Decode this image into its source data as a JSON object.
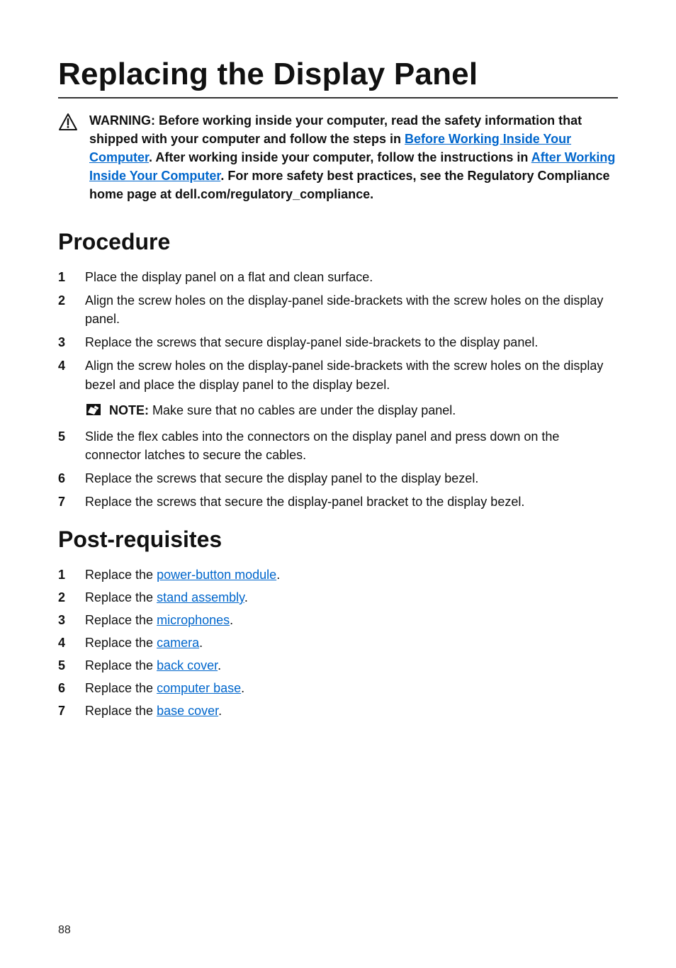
{
  "page": {
    "number": "88"
  },
  "title": "Replacing the Display Panel",
  "warning": {
    "label": "WARNING:",
    "part1": " Before working inside your computer, read the safety information that shipped with your computer and follow the steps in ",
    "link1": "Before Working Inside Your Computer",
    "part2": ". After working inside your computer, follow the instructions in ",
    "link2": "After Working Inside Your Computer",
    "part3": ". For more safety best practices, see the Regulatory Compliance home page at dell.com/regulatory_compliance."
  },
  "procedure": {
    "heading": "Procedure",
    "steps": [
      "Place the display panel on a flat and clean surface.",
      "Align the screw holes on the display-panel side-brackets with the screw holes on the display panel.",
      "Replace the screws that secure display-panel side-brackets to the display panel.",
      "Align the screw holes on the display-panel side-brackets with the screw holes on the display bezel and place the display panel to the display bezel.",
      "Slide the flex cables into the connectors on the display panel and press down on the connector latches to secure the cables.",
      "Replace the screws that secure the display panel to the display bezel.",
      "Replace the screws that secure the display-panel bracket to the display bezel."
    ],
    "note": {
      "label": "NOTE:",
      "text": " Make sure that no cables are under the display panel."
    }
  },
  "postreq": {
    "heading": "Post-requisites",
    "items": [
      {
        "prefix": "Replace the ",
        "link": "power-button module",
        "suffix": "."
      },
      {
        "prefix": "Replace the ",
        "link": "stand assembly",
        "suffix": "."
      },
      {
        "prefix": "Replace the ",
        "link": "microphones",
        "suffix": "."
      },
      {
        "prefix": "Replace the ",
        "link": "camera",
        "suffix": "."
      },
      {
        "prefix": "Replace the ",
        "link": "back cover",
        "suffix": "."
      },
      {
        "prefix": "Replace the ",
        "link": "computer base",
        "suffix": "."
      },
      {
        "prefix": "Replace the ",
        "link": "base cover",
        "suffix": "."
      }
    ]
  }
}
